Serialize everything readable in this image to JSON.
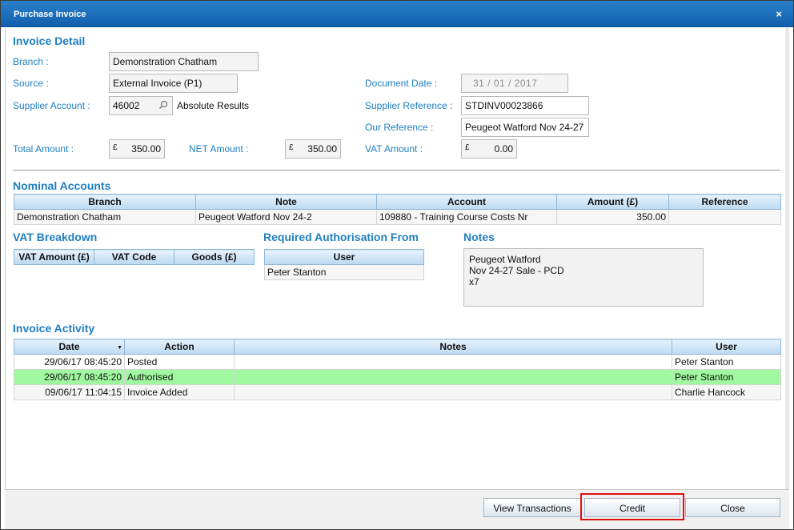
{
  "window": {
    "title": "Purchase Invoice",
    "close_glyph": "×"
  },
  "invoice_detail": {
    "section_title": "Invoice Detail",
    "branch_label": "Branch :",
    "branch_value": "Demonstration Chatham",
    "source_label": "Source :",
    "source_value": "External Invoice (P1)",
    "supplier_account_label": "Supplier Account :",
    "supplier_account_value": "46002",
    "supplier_name": "Absolute Results",
    "document_date_label": "Document Date :",
    "document_date_value": "31 /  01 /  2017",
    "supplier_reference_label": "Supplier Reference :",
    "supplier_reference_value": "STDINV00023866",
    "our_reference_label": "Our Reference :",
    "our_reference_value": "Peugeot Watford Nov 24-27",
    "total_amount_label": "Total Amount :",
    "total_amount_value": "350.00",
    "net_amount_label": "NET Amount :",
    "net_amount_value": "350.00",
    "vat_amount_label": "VAT Amount :",
    "vat_amount_value": "0.00",
    "currency_symbol": "£"
  },
  "nominal_accounts": {
    "section_title": "Nominal Accounts",
    "columns": [
      "Branch",
      "Note",
      "Account",
      "Amount (£)",
      "Reference"
    ],
    "rows": [
      [
        "Demonstration Chatham",
        "Peugeot Watford Nov 24-2",
        "109880 - Training Course Costs Nr",
        "350.00",
        ""
      ]
    ]
  },
  "vat_breakdown": {
    "section_title": "VAT Breakdown",
    "columns": [
      "VAT Amount (£)",
      "VAT Code",
      "Goods (£)"
    ]
  },
  "required_authorisation": {
    "section_title": "Required Authorisation From",
    "columns": [
      "User"
    ],
    "rows": [
      [
        "Peter Stanton"
      ]
    ]
  },
  "notes": {
    "section_title": "Notes",
    "lines": [
      "Peugeot Watford",
      "Nov 24-27 Sale - PCD",
      "x7"
    ]
  },
  "invoice_activity": {
    "section_title": "Invoice Activity",
    "columns": [
      "Date",
      "Action",
      "Notes",
      "User"
    ],
    "rows": [
      [
        "29/06/17 08:45:20",
        "Posted",
        "",
        "Peter Stanton"
      ],
      [
        "29/06/17 08:45:20",
        "Authorised",
        "",
        "Peter Stanton"
      ],
      [
        "09/06/17 11:04:15",
        "Invoice Added",
        "",
        "Charlie Hancock"
      ]
    ]
  },
  "footer": {
    "view_transactions_label": "View Transactions",
    "credit_label": "Credit",
    "close_label": "Close"
  },
  "colors": {
    "accent": "#1f7fc0",
    "title_bar": "#1a6dbb",
    "highlight_row": "#a0f9a0",
    "annotation": "#e01010"
  }
}
